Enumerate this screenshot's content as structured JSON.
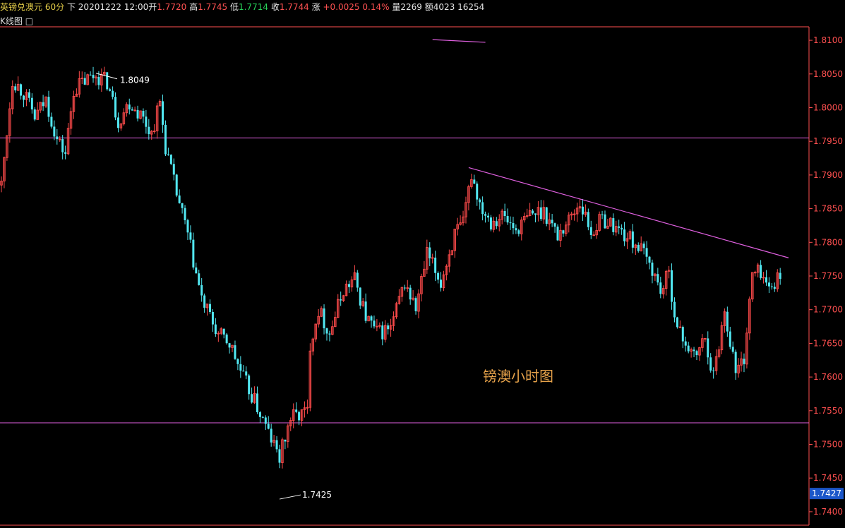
{
  "header": {
    "symbol": "英镑兑澳元",
    "period": "60分",
    "nav": "下",
    "datetime": "20201222 12:00",
    "open_label": "开",
    "open": "1.7720",
    "high_label": "高",
    "high": "1.7745",
    "low_label": "低",
    "low": "1.7714",
    "close_label": "收",
    "close": "1.7744",
    "change_label": "涨",
    "change": "+0.0025",
    "change_pct": "0.14%",
    "volume_label": "量",
    "volume": "2269",
    "amount_label": "额",
    "amount": "4023",
    "extra": "16254"
  },
  "subtitle": "K线图",
  "subtitle_icon": "window-icon",
  "colors": {
    "up": "#ff4b4b",
    "down": "#52e8f2",
    "line": "#e060e0",
    "axis": "#ff5050",
    "label": "#e6a24a"
  },
  "chart_data": {
    "type": "candlestick",
    "title": "镑澳小时图",
    "yticks": [
      "1.8100",
      "1.8050",
      "1.8000",
      "1.7950",
      "1.7900",
      "1.7850",
      "1.7800",
      "1.7750",
      "1.7700",
      "1.7650",
      "1.7600",
      "1.7550",
      "1.7500",
      "1.7450",
      "1.7400"
    ],
    "ylim": [
      1.738,
      1.812
    ],
    "current_price": "1.7427",
    "high_annotation": "1.8049",
    "low_annotation": "1.7425",
    "horizontal_lines": [
      1.7955,
      1.7532
    ],
    "trendlines": [
      {
        "from": [
          155,
          1.8101
        ],
        "to": [
          174,
          1.8097
        ]
      },
      {
        "from": [
          168,
          1.7911
        ],
        "to": [
          283,
          1.7777
        ]
      }
    ],
    "anchors": [
      [
        0,
        1.7885
      ],
      [
        2,
        1.7965
      ],
      [
        4,
        1.8042
      ],
      [
        8,
        1.8022
      ],
      [
        12,
        1.7985
      ],
      [
        16,
        1.8012
      ],
      [
        20,
        1.7952
      ],
      [
        23,
        1.7932
      ],
      [
        26,
        1.8026
      ],
      [
        30,
        1.804
      ],
      [
        34,
        1.8049
      ],
      [
        38,
        1.8038
      ],
      [
        42,
        1.798
      ],
      [
        46,
        1.8008
      ],
      [
        50,
        1.799
      ],
      [
        54,
        1.7962
      ],
      [
        57,
        1.8008
      ],
      [
        59,
        1.7942
      ],
      [
        62,
        1.7888
      ],
      [
        67,
        1.781
      ],
      [
        72,
        1.7715
      ],
      [
        78,
        1.7662
      ],
      [
        82,
        1.765
      ],
      [
        87,
        1.7598
      ],
      [
        92,
        1.7555
      ],
      [
        98,
        1.7498
      ],
      [
        100,
        1.748
      ],
      [
        104,
        1.754
      ],
      [
        110,
        1.7548
      ],
      [
        111,
        1.765
      ],
      [
        114,
        1.77
      ],
      [
        118,
        1.7665
      ],
      [
        123,
        1.773
      ],
      [
        127,
        1.7745
      ],
      [
        131,
        1.769
      ],
      [
        135,
        1.7665
      ],
      [
        140,
        1.7672
      ],
      [
        145,
        1.774
      ],
      [
        149,
        1.77
      ],
      [
        153,
        1.7782
      ],
      [
        158,
        1.774
      ],
      [
        163,
        1.7812
      ],
      [
        166,
        1.7825
      ],
      [
        169,
        1.7902
      ],
      [
        172,
        1.7858
      ],
      [
        176,
        1.7832
      ],
      [
        180,
        1.784
      ],
      [
        185,
        1.7818
      ],
      [
        190,
        1.784
      ],
      [
        195,
        1.7848
      ],
      [
        200,
        1.781
      ],
      [
        205,
        1.784
      ],
      [
        208,
        1.786
      ],
      [
        212,
        1.7815
      ],
      [
        216,
        1.7835
      ],
      [
        220,
        1.7825
      ],
      [
        225,
        1.7808
      ],
      [
        229,
        1.7795
      ],
      [
        234,
        1.776
      ],
      [
        237,
        1.7728
      ],
      [
        240,
        1.7752
      ],
      [
        243,
        1.767
      ],
      [
        246,
        1.7652
      ],
      [
        249,
        1.7628
      ],
      [
        253,
        1.7658
      ],
      [
        256,
        1.7602
      ],
      [
        260,
        1.7698
      ],
      [
        262,
        1.7655
      ],
      [
        264,
        1.7608
      ],
      [
        267,
        1.7628
      ],
      [
        270,
        1.7752
      ],
      [
        273,
        1.7758
      ],
      [
        276,
        1.7728
      ],
      [
        278,
        1.7744
      ]
    ]
  }
}
